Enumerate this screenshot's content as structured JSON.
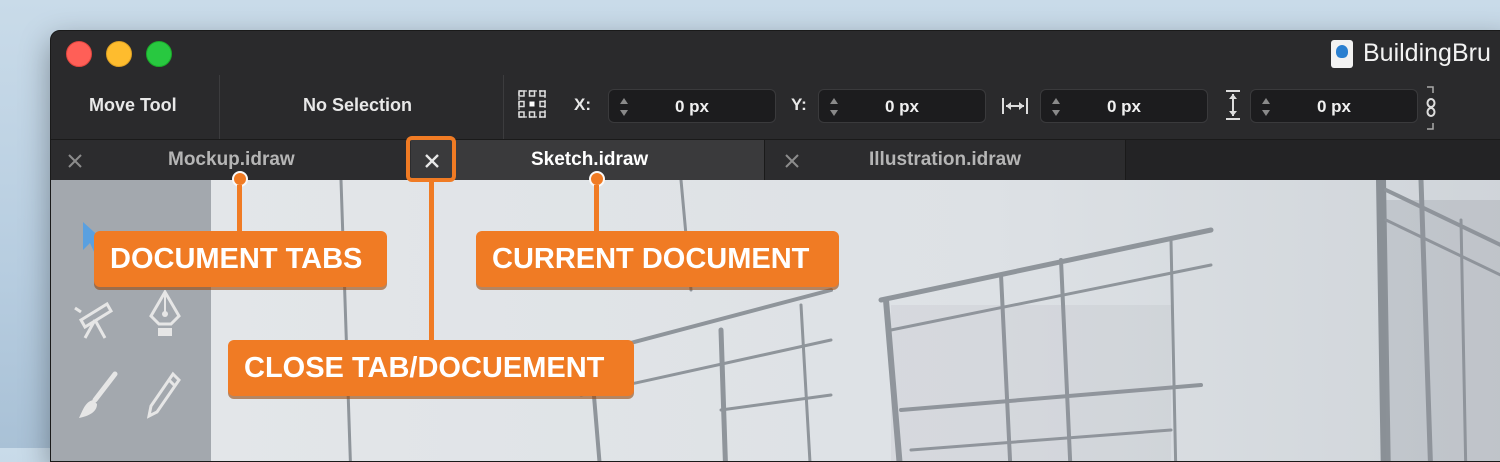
{
  "window": {
    "title": "BuildingBru",
    "traffic_lights": [
      "close",
      "minimize",
      "maximize"
    ]
  },
  "toolbar": {
    "tool_name": "Move Tool",
    "selection": "No Selection",
    "x_label": "X:",
    "x_value": "0 px",
    "y_label": "Y:",
    "y_value": "0 px",
    "width_value": "0 px",
    "height_value": "0 px",
    "icons": [
      "align-grid-icon",
      "width-arrows-icon",
      "height-arrows-icon",
      "link-icon"
    ]
  },
  "tabs": [
    {
      "label": "Mockup.idraw",
      "active": false
    },
    {
      "label": "Sketch.idraw",
      "active": true
    },
    {
      "label": "Illustration.idraw",
      "active": false
    }
  ],
  "tools": [
    "move-arrow-icon",
    "telescope-icon",
    "pen-icon",
    "brush-icon",
    "pencil-icon"
  ],
  "callouts": {
    "document_tabs": "DOCUMENT TABS",
    "current_document": "CURRENT DOCUMENT",
    "close_tab": "CLOSE TAB/DOCUEMENT"
  },
  "colors": {
    "callout_orange": "#f07b24",
    "toolbar_bg": "#2a2a2c",
    "active_tab": "#3a3a3c"
  }
}
